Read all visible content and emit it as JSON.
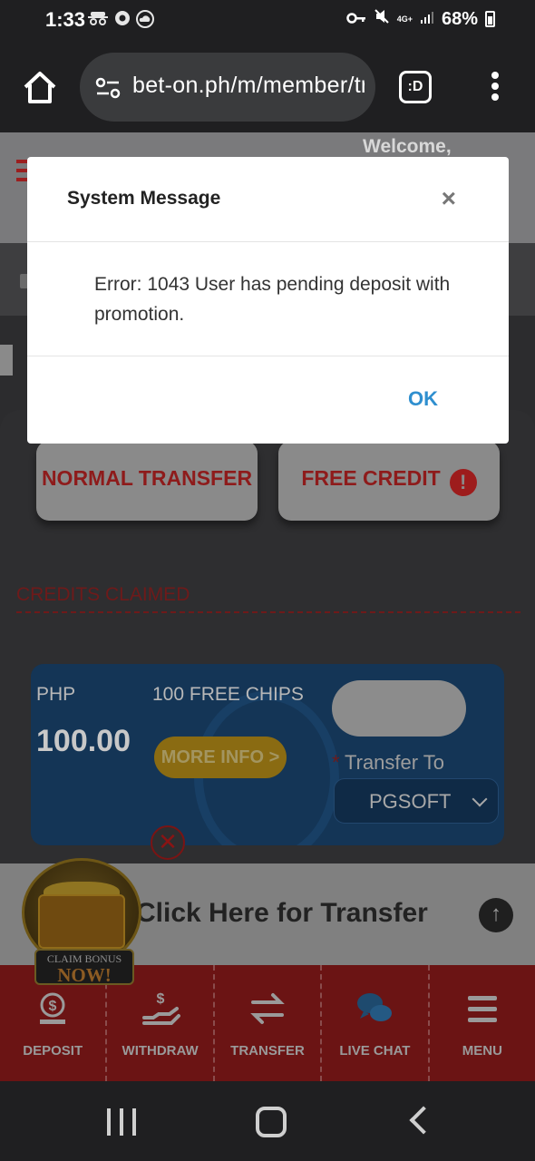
{
  "status_bar": {
    "time": "1:33",
    "left_icons": [
      "incognito-icon",
      "chrome-icon",
      "cloud-icon"
    ],
    "network": "4G+",
    "battery": "68%"
  },
  "browser": {
    "url": "bet-on.ph/m/member/tr",
    "tab_label": ":D"
  },
  "site": {
    "welcome_text": "Welcome,"
  },
  "transfer_tabs": {
    "normal": "NORMAL TRANSFER",
    "free": "FREE CREDIT",
    "free_alert": "!"
  },
  "credits_claimed_heading": "CREDITS CLAIMED",
  "credit_card": {
    "currency": "PHP",
    "title": "100 FREE CHIPS",
    "amount": "100.00",
    "more_info": "MORE INFO >",
    "transfer_to_label": "Transfer To",
    "transfer_to_value": "PGSOFT"
  },
  "remove_glyph": "✕",
  "transfer_bar": {
    "text": "Click Here for Transfer",
    "arrow": "↑"
  },
  "bonus_badge": {
    "line1": "CLAIM BONUS",
    "line2": "NOW!"
  },
  "bottom_nav": [
    {
      "label": "DEPOSIT",
      "icon": "deposit-icon"
    },
    {
      "label": "WITHDRAW",
      "icon": "withdraw-icon"
    },
    {
      "label": "TRANSFER",
      "icon": "transfer-icon"
    },
    {
      "label": "LIVE CHAT",
      "icon": "live-chat-icon"
    },
    {
      "label": "MENU",
      "icon": "menu-icon"
    }
  ],
  "modal": {
    "title": "System Message",
    "close": "×",
    "message": "Error: 1043 User has pending deposit with promotion.",
    "ok": "OK"
  },
  "colors": {
    "accent_red": "#b22222",
    "ok_blue": "#2f8fcf",
    "nav_red": "#6b1414"
  }
}
